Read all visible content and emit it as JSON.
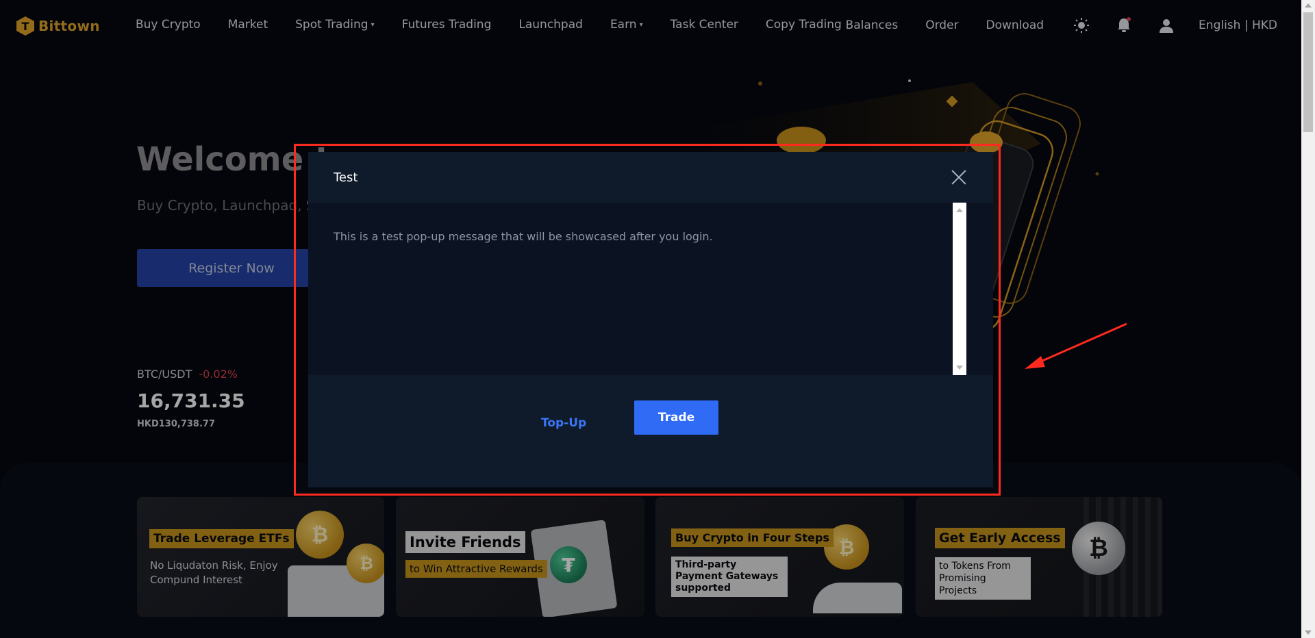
{
  "brand": {
    "name": "Bittown"
  },
  "nav": {
    "items": [
      {
        "label": "Buy Crypto",
        "caret": false
      },
      {
        "label": "Market",
        "caret": false
      },
      {
        "label": "Spot Trading",
        "caret": true
      },
      {
        "label": "Futures Trading",
        "caret": false
      },
      {
        "label": "Launchpad",
        "caret": false
      },
      {
        "label": "Earn",
        "caret": true
      },
      {
        "label": "Task Center",
        "caret": false
      },
      {
        "label": "Copy Trading",
        "caret": false
      }
    ],
    "right": {
      "balances": "Balances",
      "order": "Order",
      "download": "Download",
      "language": "English | HKD"
    }
  },
  "hero": {
    "title": "Welcome to",
    "subtitle": "Buy Crypto, Launchpad, S",
    "register_label": "Register Now"
  },
  "ticker": {
    "pair": "BTC/USDT",
    "change": "-0.02%",
    "price": "16,731.35",
    "fiat": "HKD130,738.77"
  },
  "cards": [
    {
      "title": "Trade Leverage ETFs",
      "desc": "No Liqudaton Risk, Enjoy Compund Interest"
    },
    {
      "title": "Invite Friends",
      "desc": "to Win Attractive Rewards"
    },
    {
      "title": "Buy Crypto in Four Steps",
      "desc": "Third-party Payment Gateways supported"
    },
    {
      "title": "Get Early Access",
      "desc": "to Tokens From Promising Projects"
    }
  ],
  "modal": {
    "title": "Test",
    "message": "This is a test pop-up message that will be showcased after you login.",
    "topup_label": "Top-Up",
    "trade_label": "Trade"
  },
  "colors": {
    "brand_gold": "#e3a52a",
    "primary_blue": "#2f6bf5",
    "negative_red": "#e0414f",
    "annotation_red": "#ff2a1f"
  },
  "icons": {
    "theme": "sun-icon",
    "notifications": "bell-icon",
    "account": "user-icon",
    "close": "close-icon",
    "coin": "bitcoin-icon"
  }
}
